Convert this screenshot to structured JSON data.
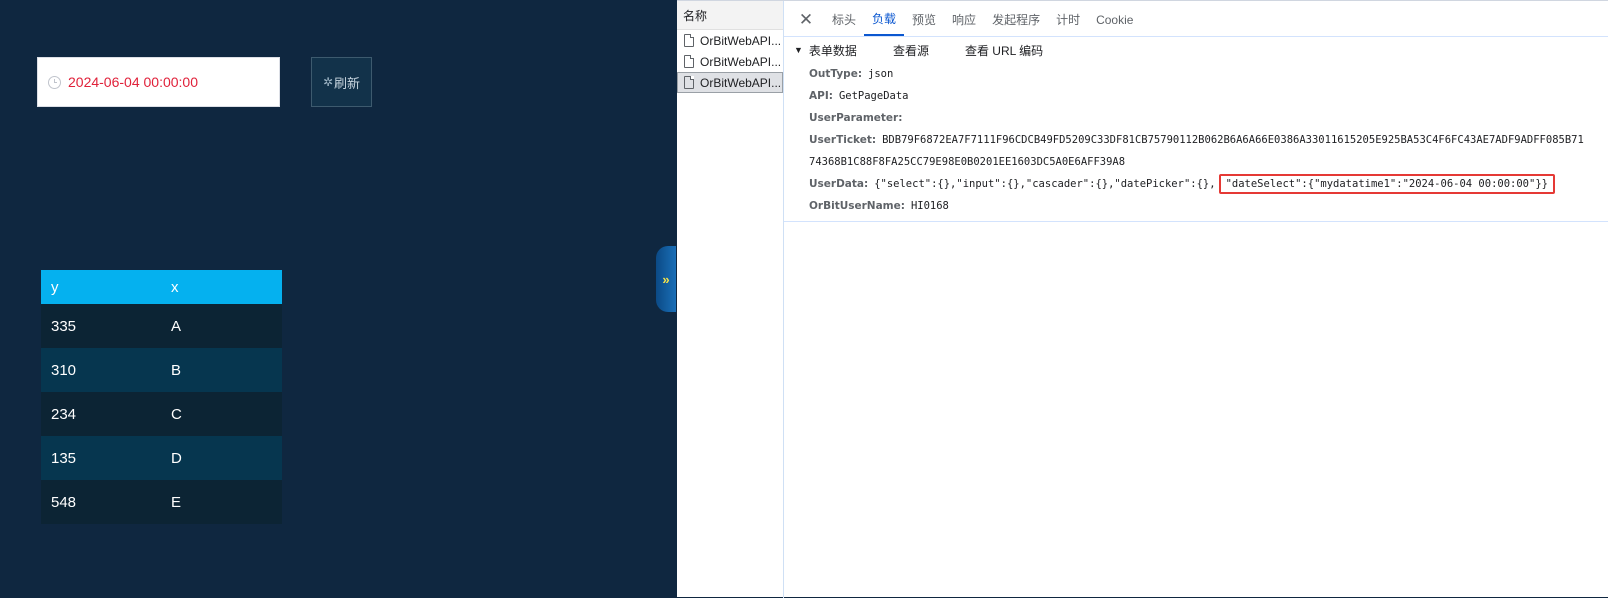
{
  "dashboard": {
    "date_value": "2024-06-04 00:00:00",
    "refresh_label": "刷新",
    "table": {
      "headers": [
        "y",
        "x"
      ],
      "rows": [
        [
          "335",
          "A"
        ],
        [
          "310",
          "B"
        ],
        [
          "234",
          "C"
        ],
        [
          "135",
          "D"
        ],
        [
          "548",
          "E"
        ]
      ]
    },
    "collapse_glyph": "»"
  },
  "devtools": {
    "list_header": "名称",
    "requests": [
      "OrBitWebAPI...",
      "OrBitWebAPI...",
      "OrBitWebAPI..."
    ],
    "selected_index": 2,
    "tabs": [
      "标头",
      "负载",
      "预览",
      "响应",
      "发起程序",
      "计时",
      "Cookie"
    ],
    "active_tab": "负载",
    "section": {
      "title": "表单数据",
      "view_source": "查看源",
      "view_url_encoded": "查看 URL 编码"
    },
    "fields": {
      "outtype_key": "OutType:",
      "outtype_val": "json",
      "api_key": "API:",
      "api_val": "GetPageData",
      "userparam_key": "UserParameter:",
      "userparam_val": "",
      "userticket_key": "UserTicket:",
      "userticket_val": "BDB79F6872EA7F7111F96CDCB49FD5209C33DF81CB75790112B062B6A6A66E0386A33011615205E925BA53C4F6FC43AE7ADF9ADFF085B71",
      "userticket_val2": "74368B1C88F8FA25CC79E98E0B0201EE1603DC5A0E6AFF39A8",
      "userdata_key": "UserData:",
      "userdata_val": "{\"select\":{},\"input\":{},\"cascader\":{},\"datePicker\":{},",
      "userdata_highlight": "\"dateSelect\":{\"mydatatime1\":\"2024-06-04 00:00:00\"}}",
      "orbituser_key": "OrBitUserName:",
      "orbituser_val": "HI0168"
    },
    "colors": {
      "accent": "#0b57d0",
      "highlight_border": "#e53935",
      "table_header": "#05b1ef",
      "dashboard_bg": "#0f2740"
    }
  }
}
